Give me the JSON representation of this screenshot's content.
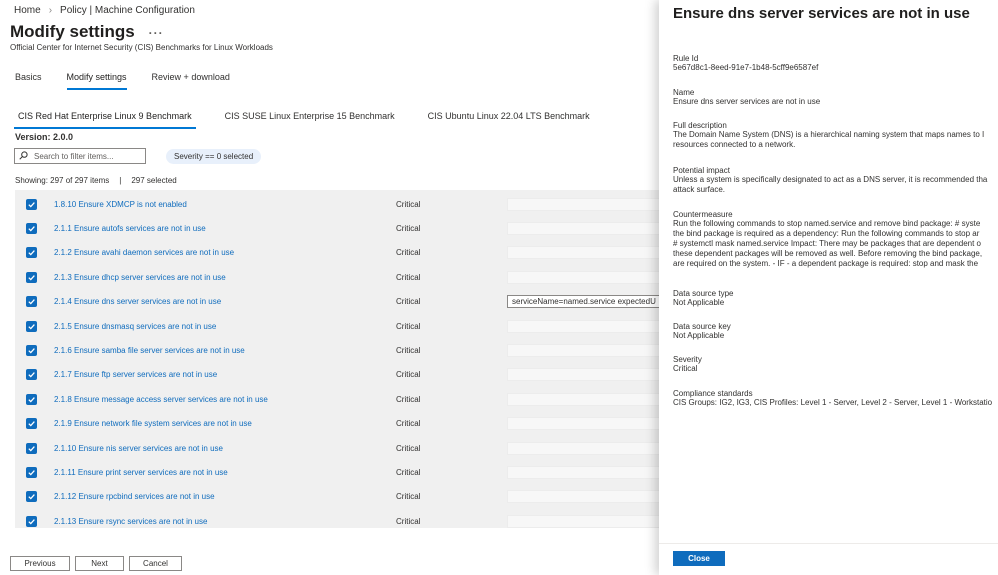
{
  "breadcrumb": {
    "home": "Home",
    "current": "Policy | Machine Configuration"
  },
  "page": {
    "title": "Modify settings",
    "more": "···",
    "subtitle": "Official Center for Internet Security (CIS) Benchmarks for Linux Workloads"
  },
  "tabs": [
    "Basics",
    "Modify settings",
    "Review + download"
  ],
  "benchmark_tabs": [
    "CIS Red Hat Enterprise Linux 9 Benchmark",
    "CIS SUSE Linux Enterprise 15 Benchmark",
    "CIS Ubuntu Linux 22.04 LTS Benchmark"
  ],
  "version": {
    "label": "Version:",
    "value": "2.0.0"
  },
  "filter": {
    "placeholder": "Search to filter items...",
    "severity_pill": "Severity == 0 selected"
  },
  "showing": {
    "text": "Showing: 297 of 297 items",
    "divider": "|",
    "selected": "297 selected"
  },
  "rules": [
    {
      "name": "1.8.10 Ensure XDMCP is not enabled",
      "severity": "Critical",
      "value": ""
    },
    {
      "name": "2.1.1 Ensure autofs services are not in use",
      "severity": "Critical",
      "value": ""
    },
    {
      "name": "2.1.2 Ensure avahi daemon services are not in use",
      "severity": "Critical",
      "value": ""
    },
    {
      "name": "2.1.3 Ensure dhcp server services are not in use",
      "severity": "Critical",
      "value": ""
    },
    {
      "name": "2.1.4 Ensure dns server services are not in use",
      "severity": "Critical",
      "value": "serviceName=named.service expectedU"
    },
    {
      "name": "2.1.5 Ensure dnsmasq services are not in use",
      "severity": "Critical",
      "value": ""
    },
    {
      "name": "2.1.6 Ensure samba file server services are not in use",
      "severity": "Critical",
      "value": ""
    },
    {
      "name": "2.1.7 Ensure ftp server services are not in use",
      "severity": "Critical",
      "value": ""
    },
    {
      "name": "2.1.8 Ensure message access server services are not in use",
      "severity": "Critical",
      "value": ""
    },
    {
      "name": "2.1.9 Ensure network file system services are not in use",
      "severity": "Critical",
      "value": ""
    },
    {
      "name": "2.1.10 Ensure nis server services are not in use",
      "severity": "Critical",
      "value": ""
    },
    {
      "name": "2.1.11 Ensure print server services are not in use",
      "severity": "Critical",
      "value": ""
    },
    {
      "name": "2.1.12 Ensure rpcbind services are not in use",
      "severity": "Critical",
      "value": ""
    },
    {
      "name": "2.1.13 Ensure rsync services are not in use",
      "severity": "Critical",
      "value": ""
    }
  ],
  "footer": {
    "previous": "Previous",
    "next": "Next",
    "cancel": "Cancel"
  },
  "panel": {
    "title": "Ensure dns server services are not in use",
    "rule_id_label": "Rule Id",
    "rule_id": "5e67d8c1-8eed-91e7-1b48-5cff9e6587ef",
    "name_label": "Name",
    "name": "Ensure dns server services are not in use",
    "full_description_label": "Full description",
    "full_description": "The Domain Name System (DNS) is a hierarchical naming system that maps names to I\nresources connected to a network.",
    "potential_impact_label": "Potential impact",
    "potential_impact": "Unless a system is specifically designated to act as a DNS server, it is recommended tha\nattack surface.",
    "countermeasure_label": "Countermeasure",
    "countermeasure": "Run the following commands to stop named.service and remove bind package: # syste\nthe bind package is required as a dependency: Run the following commands to stop ar\n# systemctl mask named.service Impact: There may be packages that are dependent o\nthese dependent packages will be removed as well. Before removing the bind package,\nare required on the system. - IF - a dependent package is required: stop and mask the",
    "data_source_type_label": "Data source type",
    "data_source_type": "Not Applicable",
    "data_source_key_label": "Data source key",
    "data_source_key": "Not Applicable",
    "severity_label": "Severity",
    "severity": "Critical",
    "compliance_label": "Compliance standards",
    "compliance": "CIS Groups: IG2, IG3, CIS Profiles: Level 1 - Server, Level 2 - Server, Level 1 - Workstatio",
    "close": "Close"
  },
  "colors": {
    "accent": "#0f6cbd",
    "link": "#0f6cbd",
    "table_bg": "#f0f0f0"
  }
}
